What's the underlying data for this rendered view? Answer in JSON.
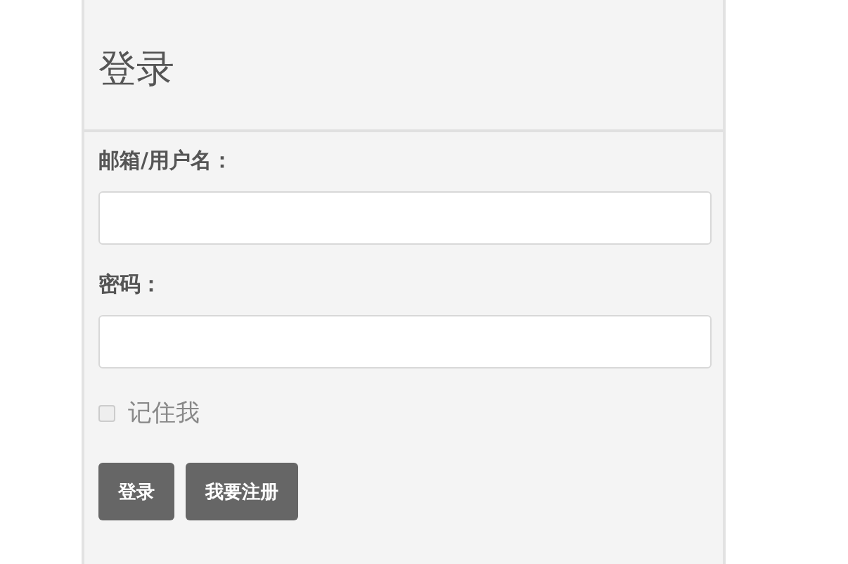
{
  "title": "登录",
  "fields": [
    {
      "label": "邮箱/用户名："
    },
    {
      "label": "密码："
    }
  ],
  "remember": {
    "label": "记住我",
    "checked": false
  },
  "buttons": [
    "登录",
    "我要注册"
  ]
}
